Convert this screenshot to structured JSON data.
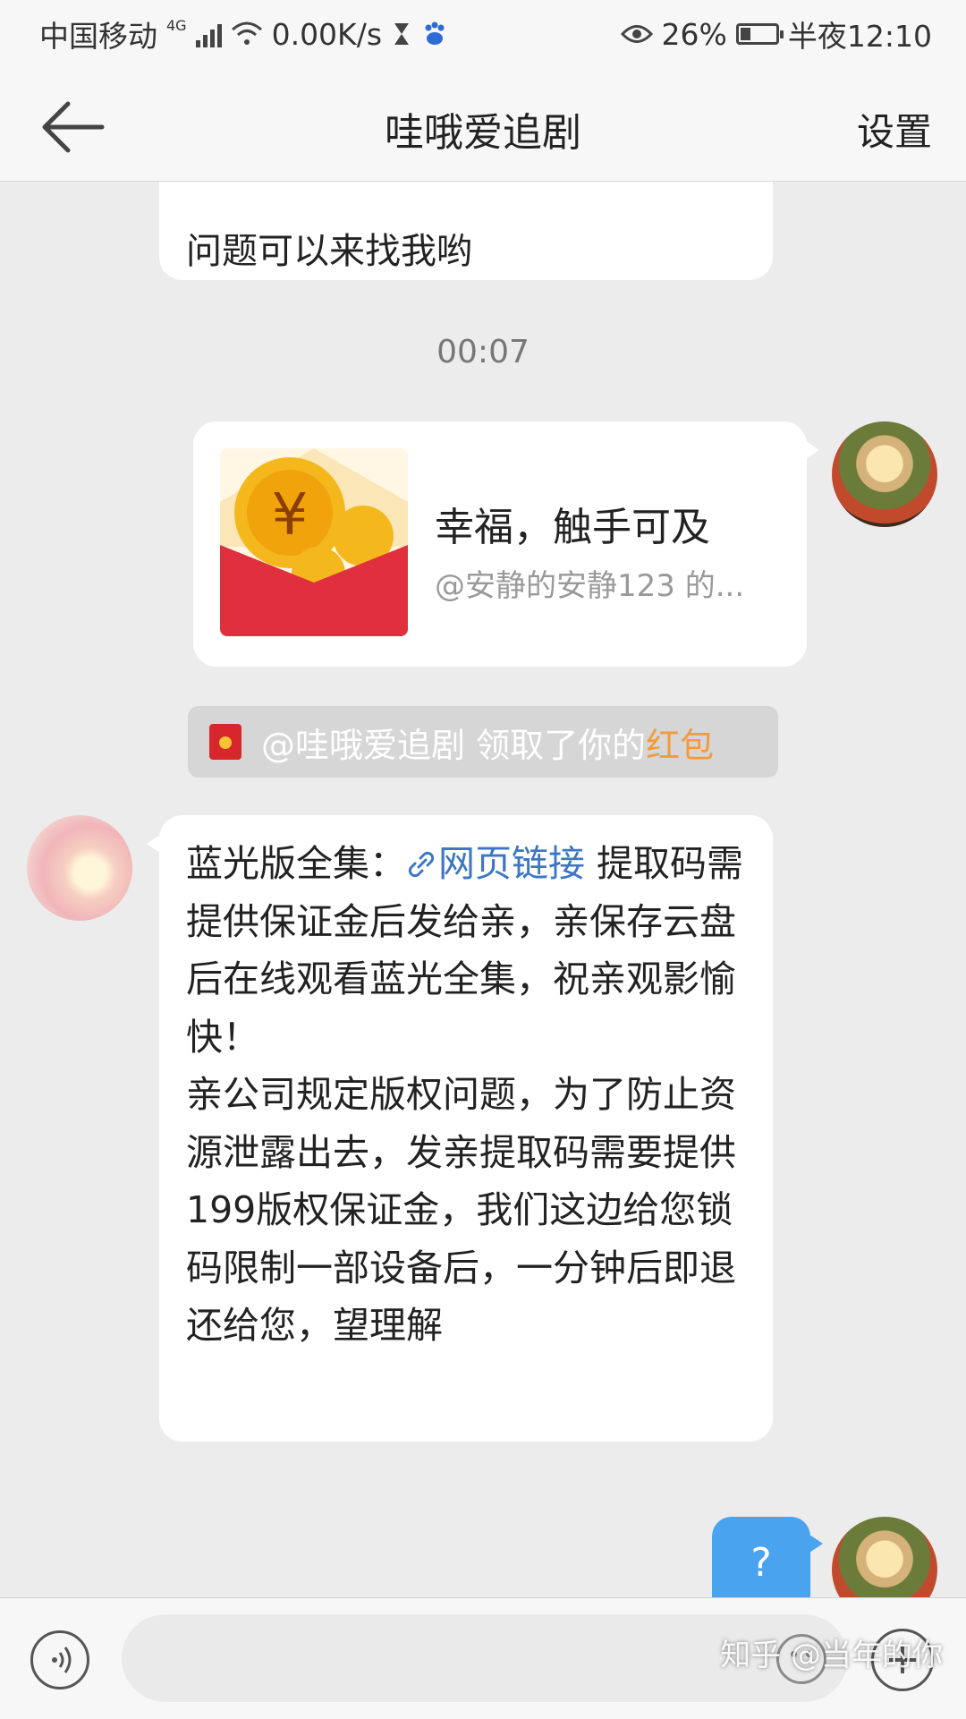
{
  "status_bar": {
    "carrier": "中国移动",
    "network_badge": "4G",
    "speed": "0.00K/s",
    "battery": "26%",
    "time": "半夜12:10",
    "icons": [
      "signal-icon",
      "wifi-icon",
      "hourglass-icon",
      "baidu-icon",
      "eye-icon",
      "battery-icon"
    ]
  },
  "nav": {
    "back_icon": "back-arrow-icon",
    "title": "哇哦爱追剧",
    "settings_label": "设置"
  },
  "messages": {
    "top_partial_text": "问题可以来找我哟",
    "timestamp": "00:07",
    "red_packet": {
      "title": "幸福，触手可及",
      "subtitle": "@安静的安静123 的..."
    },
    "notice": {
      "prefix": "@哇哦爱追剧 领取了你的",
      "highlight": "红包"
    },
    "long_message": {
      "prefix": "蓝光版全集：",
      "link_text": "网页链接",
      "body": " 提取码需提供保证金后发给亲，亲保存云盘后在线观看蓝光全集，祝亲观影愉快！\n亲公司规定版权问题，为了防止资源泄露出去，发亲提取码需要提供199版权保证金，我们这边给您锁码限制一部设备后，一分钟后即退还给您，望理解"
    },
    "question_message": "?"
  },
  "input_bar": {
    "placeholder": "",
    "watermark": "知乎 @当年的你"
  },
  "colors": {
    "link": "#3d76c4",
    "highlight": "#f39b3a",
    "sent_bubble": "#4aa3ef",
    "red_packet": "#e0303e"
  }
}
